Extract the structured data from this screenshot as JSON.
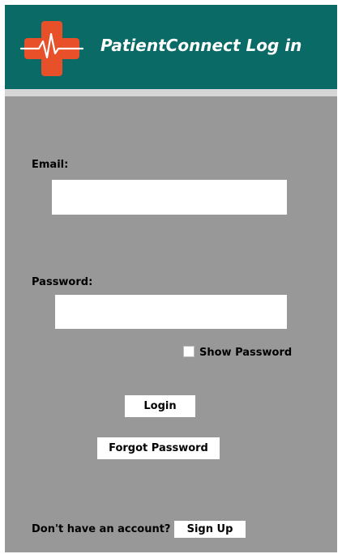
{
  "header": {
    "title": "PatientConnect Log in",
    "logo_icon": "medical-cross-heartbeat-icon",
    "background_color": "#0a6a66",
    "logo_color": "#e8502a"
  },
  "form": {
    "email_label": "Email:",
    "email_value": "",
    "password_label": "Password:",
    "password_value": "",
    "show_password_label": "Show Password",
    "show_password_checked": false,
    "login_label": "Login",
    "forgot_password_label": "Forgot Password"
  },
  "footer": {
    "no_account_text": "Don't have an account?",
    "sign_up_label": "Sign Up"
  },
  "colors": {
    "panel_background": "#989898",
    "field_background": "#ffffff"
  }
}
